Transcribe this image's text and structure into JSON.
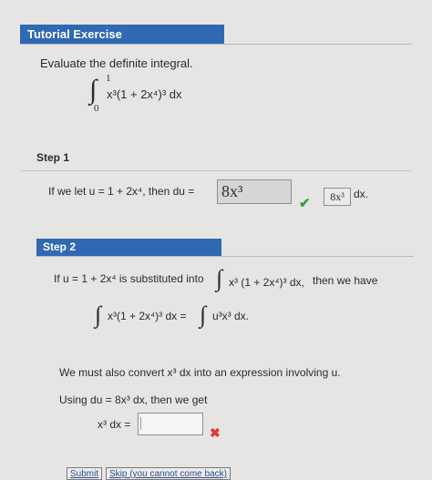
{
  "header": {
    "title": "Tutorial Exercise"
  },
  "prompt": {
    "text": "Evaluate the definite integral."
  },
  "integral": {
    "upper": "1",
    "lower": "0",
    "integrand": "x³(1 + 2x⁴)³ dx"
  },
  "step1": {
    "label": "Step 1",
    "text": "If we let u = 1 + 2x⁴, then du =",
    "answer": "8x³",
    "answer_echo": "8x³",
    "dx_label": "dx.",
    "status": "correct"
  },
  "step2": {
    "label": "Step 2",
    "sub_prefix": "If u = 1 + 2x⁴ is substituted into",
    "sub_integrand": "x³ (1 + 2x⁴)³ dx,",
    "sub_suffix": "then we have",
    "eq_left": "x³(1 + 2x⁴)³ dx =",
    "eq_right": "u³x³ dx.",
    "convert_text": "We must also convert x³ dx into an expression involving u.",
    "using_text": "Using du = 8x³ dx, then we get",
    "x3dx_label": "x³ dx =",
    "input_value": "",
    "status": "incorrect"
  },
  "buttons": {
    "submit": "Submit",
    "skip": "Skip (you cannot come back)"
  },
  "colors": {
    "accent": "#2f69b3",
    "correct": "#35a142",
    "incorrect": "#e0373a"
  }
}
